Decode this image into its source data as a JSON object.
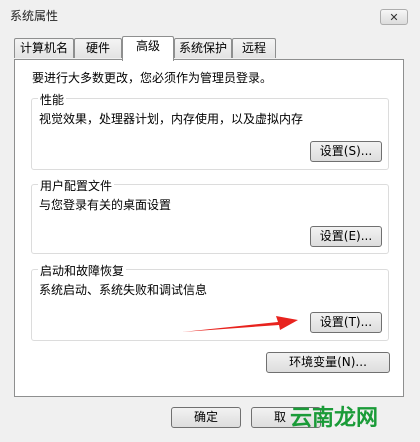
{
  "window": {
    "title": "系统属性",
    "close_label": "✕"
  },
  "tabs": [
    {
      "label": "计算机名"
    },
    {
      "label": "硬件"
    },
    {
      "label": "高级"
    },
    {
      "label": "系统保护"
    },
    {
      "label": "远程"
    }
  ],
  "active_tab": "高级",
  "intro": "要进行大多数更改，您必须作为管理员登录。",
  "groups": {
    "performance": {
      "label": "性能",
      "description": "视觉效果，处理器计划，内存使用，以及虚拟内存",
      "button": "设置(S)..."
    },
    "profile": {
      "label": "用户配置文件",
      "description": "与您登录有关的桌面设置",
      "button": "设置(E)..."
    },
    "startup": {
      "label": "启动和故障恢复",
      "description": "系统启动、系统失败和调试信息",
      "button": "设置(T)..."
    }
  },
  "env_button": "环境变量(N)...",
  "footer": {
    "ok": "确定",
    "cancel": "取"
  },
  "watermark": "云南龙网",
  "colors": {
    "arrow": "#e8231e",
    "watermark": "#1a9b38"
  }
}
